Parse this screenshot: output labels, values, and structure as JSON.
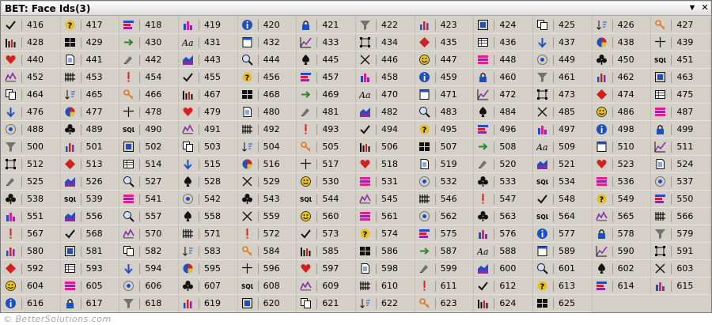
{
  "window": {
    "title": "BET: Face Ids(3)",
    "dropdown_glyph": "▼",
    "close_glyph": "✕"
  },
  "face_ids": [
    416,
    417,
    418,
    419,
    420,
    421,
    422,
    423,
    424,
    425,
    426,
    427,
    428,
    429,
    430,
    431,
    432,
    433,
    434,
    435,
    436,
    437,
    438,
    439,
    440,
    441,
    442,
    443,
    444,
    445,
    446,
    447,
    448,
    449,
    450,
    451,
    452,
    453,
    454,
    455,
    456,
    457,
    458,
    459,
    460,
    461,
    462,
    463,
    464,
    465,
    466,
    467,
    468,
    469,
    470,
    471,
    472,
    473,
    474,
    475,
    476,
    477,
    478,
    479,
    480,
    481,
    482,
    483,
    484,
    485,
    486,
    487,
    488,
    489,
    490,
    491,
    492,
    493,
    494,
    495,
    496,
    497,
    498,
    499,
    500,
    501,
    502,
    503,
    504,
    505,
    506,
    507,
    508,
    509,
    510,
    511,
    512,
    513,
    514,
    515,
    516,
    517,
    518,
    519,
    520,
    521,
    523,
    524,
    525,
    526,
    527,
    528,
    529,
    530,
    531,
    532,
    533,
    534,
    536,
    537,
    538,
    539,
    541,
    542,
    543,
    544,
    545,
    546,
    547,
    548,
    549,
    550,
    551,
    556,
    557,
    558,
    559,
    560,
    561,
    562,
    563,
    564,
    565,
    566,
    567,
    568,
    570,
    571,
    572,
    573,
    574,
    575,
    576,
    577,
    578,
    579,
    580,
    581,
    582,
    583,
    584,
    585,
    586,
    587,
    588,
    589,
    590,
    591,
    592,
    593,
    594,
    595,
    596,
    597,
    598,
    599,
    600,
    601,
    602,
    603,
    604,
    605,
    606,
    607,
    608,
    609,
    610,
    611,
    612,
    613,
    614,
    615,
    616,
    617,
    618,
    619,
    620,
    621,
    622,
    623,
    624,
    625
  ],
  "colors": {
    "blue": "#1f4fbf",
    "red": "#d42020",
    "green": "#2a8a2a",
    "yellow": "#e8c020",
    "purple": "#8a2aa8",
    "black": "#111111",
    "gray": "#707070",
    "orange": "#e07820"
  },
  "icon_cycle": [
    "pencil",
    "smiley",
    "chart-pink",
    "bars-red",
    "bar-chart",
    "bar-chart2",
    "line-chart",
    "pie",
    "area",
    "stripes",
    "fence",
    "person-chart",
    "frame",
    "grid",
    "corners",
    "plus",
    "magnify",
    "target",
    "excl",
    "info",
    "copy",
    "arrow",
    "diamond",
    "heart",
    "spade",
    "club",
    "check",
    "lock",
    "sort",
    "text-aa",
    "table",
    "doc",
    "x-mark",
    "sql",
    "question",
    "funnel",
    "key",
    "pad",
    "down"
  ],
  "footer": "© BetterSolutions.com"
}
